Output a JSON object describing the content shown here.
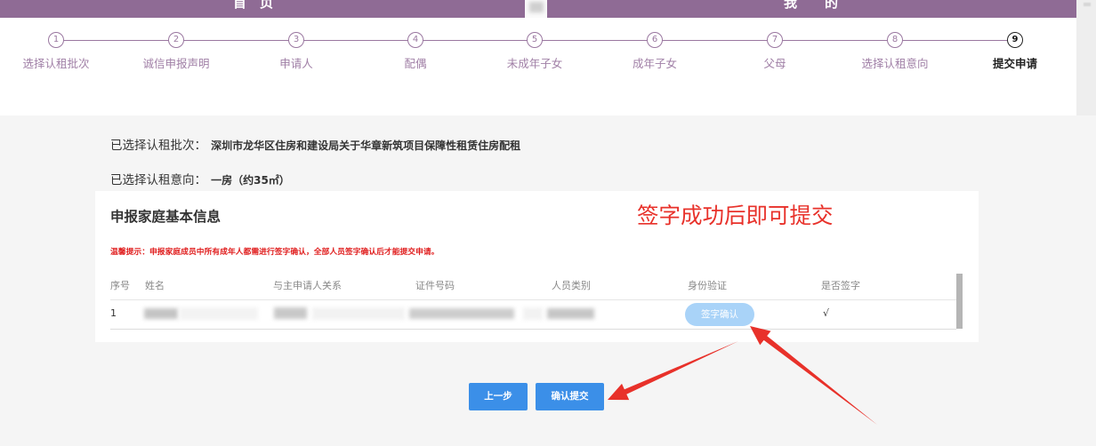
{
  "header": {
    "tabs": [
      {
        "label": "首　页"
      },
      {
        "label": "我　的"
      }
    ]
  },
  "stepper": {
    "steps": [
      {
        "num": "1",
        "label": "选择认租批次"
      },
      {
        "num": "2",
        "label": "诚信申报声明"
      },
      {
        "num": "3",
        "label": "申请人"
      },
      {
        "num": "4",
        "label": "配偶"
      },
      {
        "num": "5",
        "label": "未成年子女"
      },
      {
        "num": "6",
        "label": "成年子女"
      },
      {
        "num": "7",
        "label": "父母"
      },
      {
        "num": "8",
        "label": "选择认租意向"
      },
      {
        "num": "9",
        "label": "提交申请",
        "active": true
      }
    ]
  },
  "selection": {
    "batch_label": "已选择认租批次：",
    "batch_value": "深圳市龙华区住房和建设局关于华章新筑项目保障性租赁住房配租",
    "intent_label": "已选择认租意向：",
    "intent_value": "一房（约35㎡）"
  },
  "family": {
    "title": "申报家庭基本信息",
    "tip": "温馨提示：申报家庭成员中所有成年人都需进行签字确认，全部人员签字确认后才能提交申请。",
    "columns": [
      "序号",
      "姓名",
      "与主申请人关系",
      "证件号码",
      "人员类别",
      "身份验证",
      "是否签字"
    ],
    "rows": [
      {
        "index": "1",
        "sign_button": "签字确认",
        "signed": "√"
      }
    ]
  },
  "annotation": {
    "text": "签字成功后即可提交"
  },
  "actions": {
    "prev": "上一步",
    "submit": "确认提交"
  },
  "colors": {
    "header_purple": "#8f6b95",
    "step_purple": "#9a77a0",
    "primary_button": "#3b8fe8",
    "sign_button": "#a9d3f8",
    "annotation_red": "#e8312a",
    "tip_red": "#e02020"
  }
}
